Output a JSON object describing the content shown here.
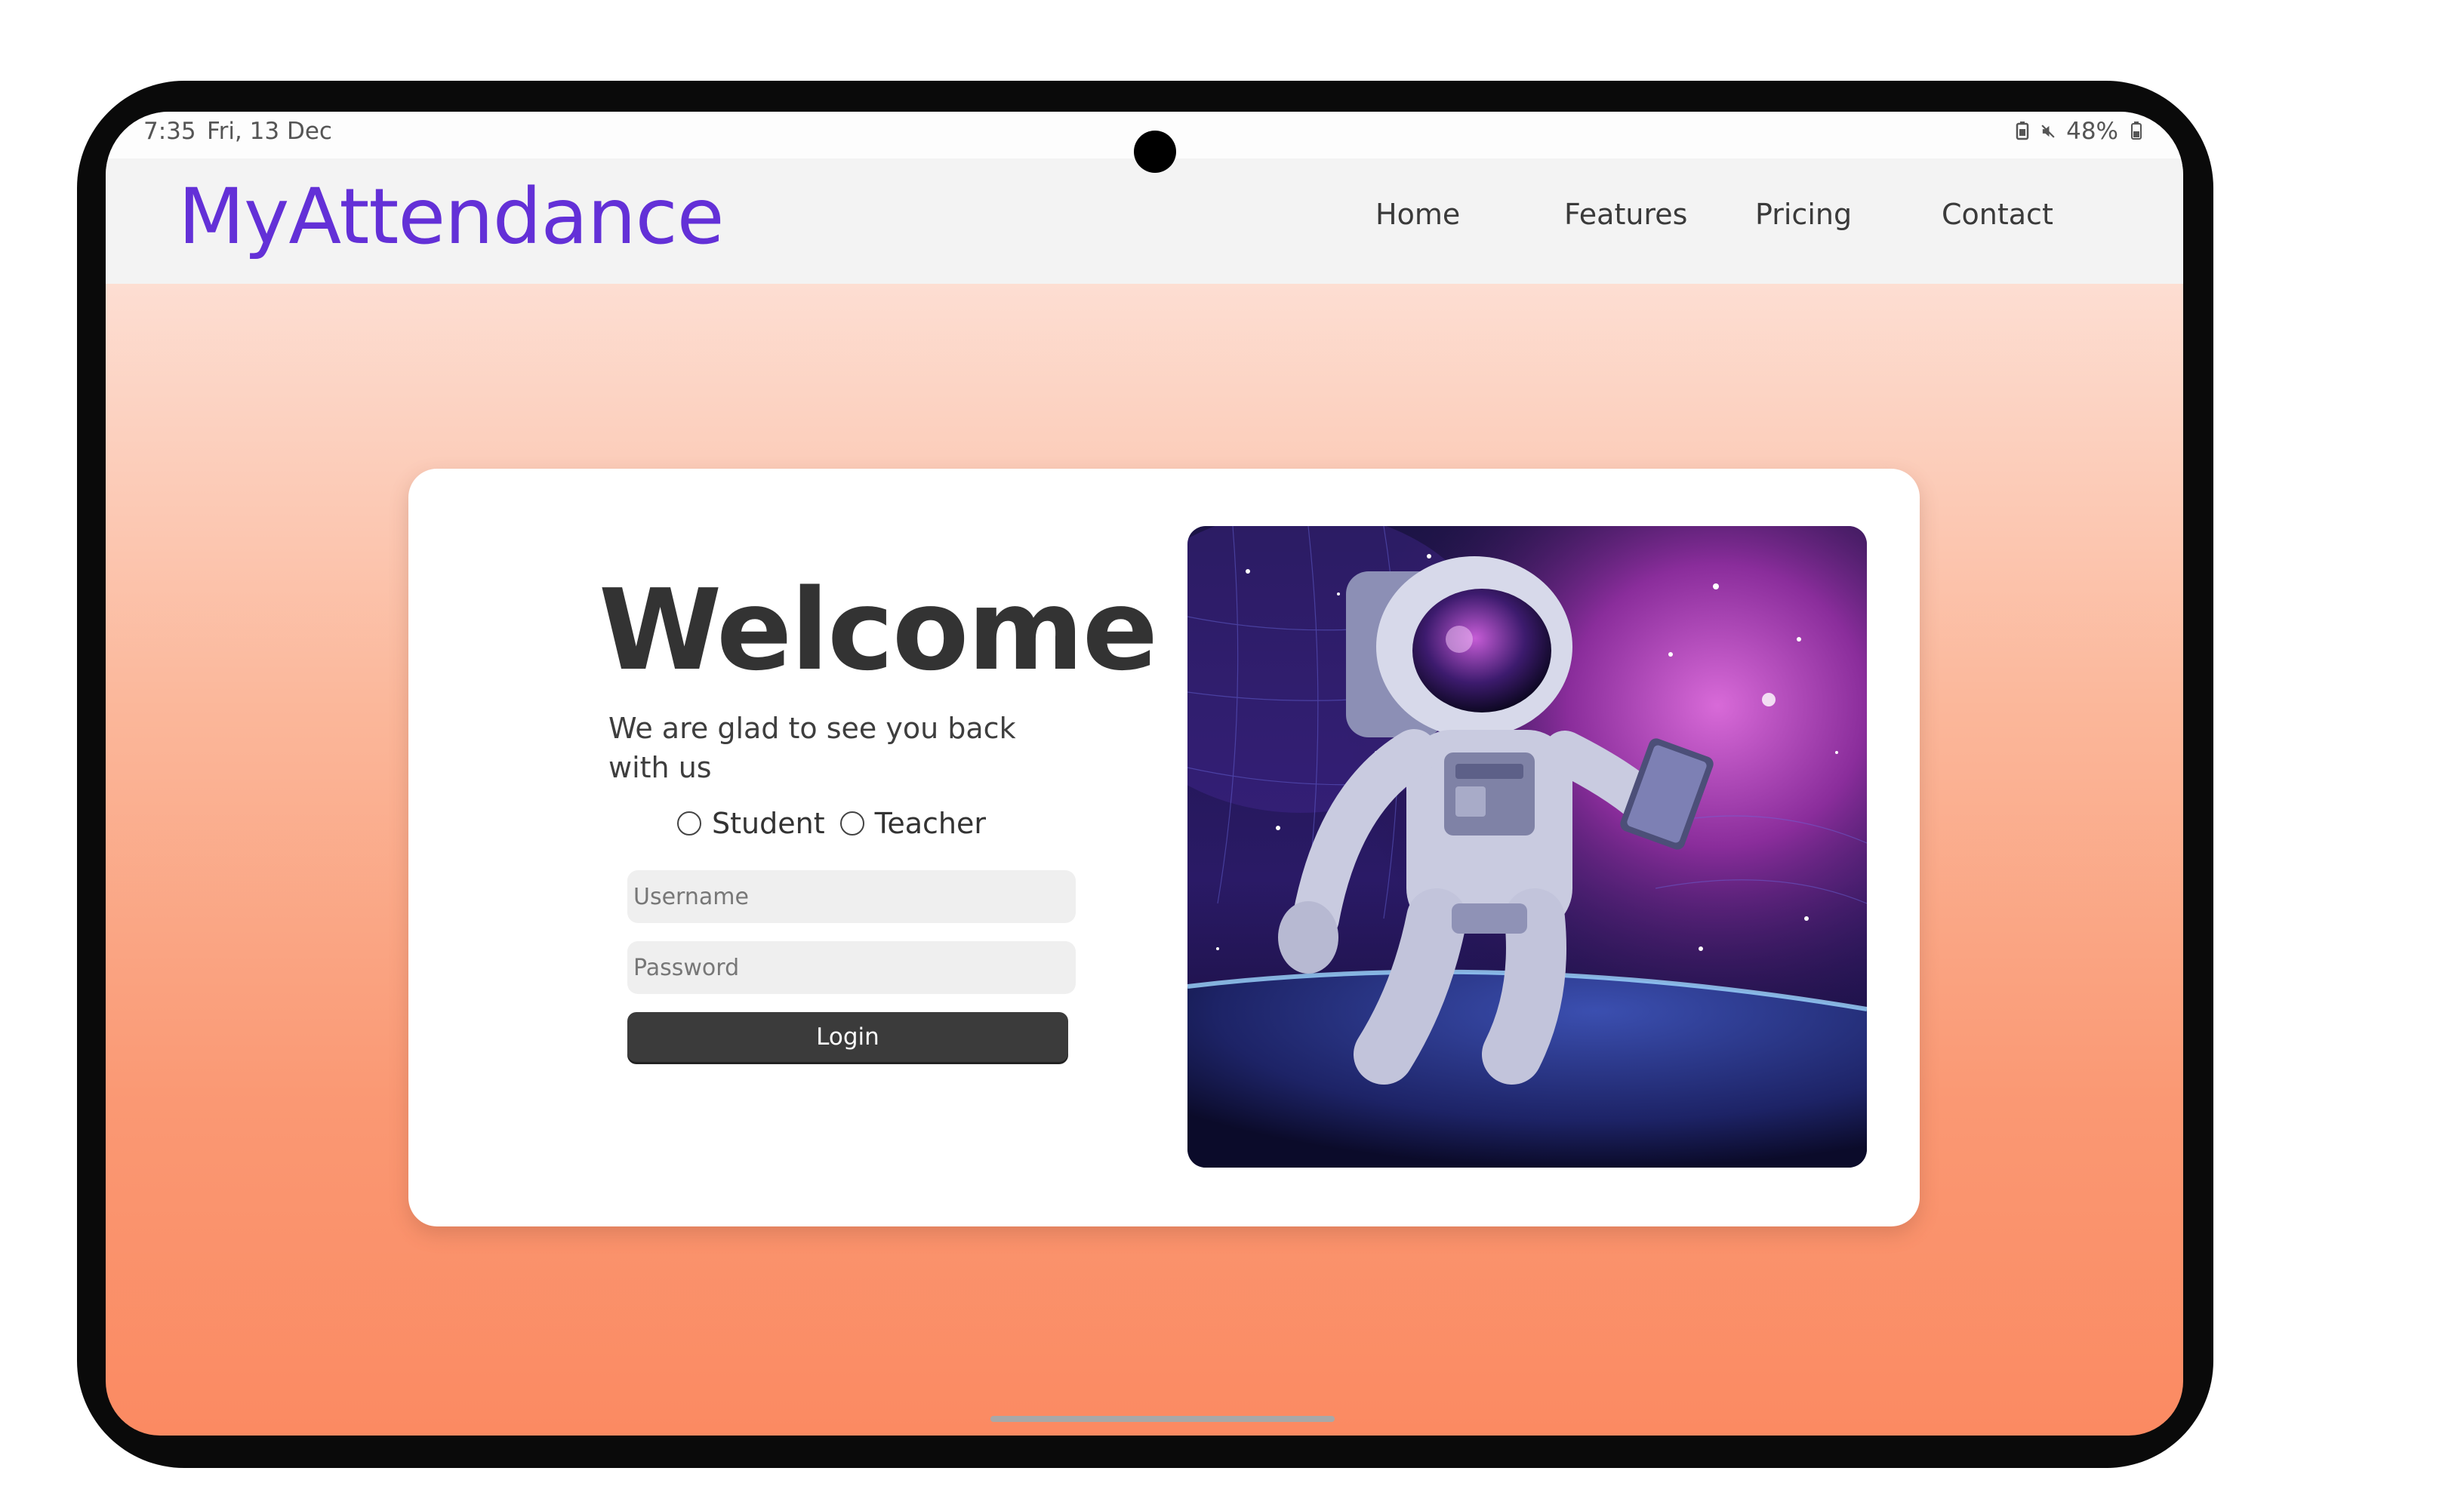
{
  "status_bar": {
    "time": "7:35",
    "date": "Fri, 13 Dec",
    "battery": "48%",
    "icons": [
      "battery-saver-icon",
      "mute-icon",
      "battery-icon"
    ]
  },
  "navbar": {
    "logo": "MyAttendance",
    "links": [
      "Home",
      "Features",
      "Pricing",
      "Contact"
    ]
  },
  "login": {
    "title": "Welcome",
    "subtitle": "We are glad to see you back with us",
    "roles": [
      "Student",
      "Teacher"
    ],
    "username_placeholder": "Username",
    "password_placeholder": "Password",
    "login_label": "Login"
  },
  "hero_image": {
    "subject": "astronaut-floating-in-space-holding-tablet"
  },
  "colors": {
    "brand": "#6330d7",
    "button": "#3b3b3b",
    "gradient_top": "#fff1ec",
    "gradient_bottom": "#fb8a62"
  }
}
